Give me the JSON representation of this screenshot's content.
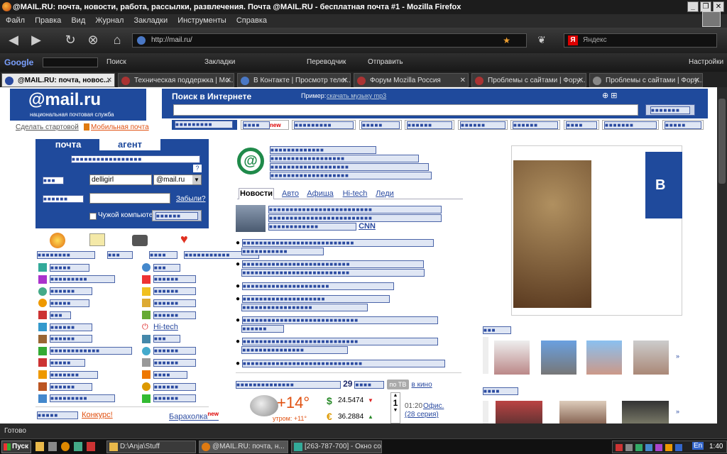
{
  "window": {
    "title": "@MAIL.RU: почта, новости, работа, рассылки, развлечения. Почта @MAIL.RU - бесплатная почта #1 - Mozilla Firefox"
  },
  "menu": [
    "Файл",
    "Правка",
    "Вид",
    "Журнал",
    "Закладки",
    "Инструменты",
    "Справка"
  ],
  "nav": {
    "url": "http://mail.ru/",
    "search_placeholder": "Яндекс"
  },
  "google_toolbar": {
    "logo": "Google",
    "search": "Поиск",
    "bookmarks": "Закладки",
    "translate": "Переводчик",
    "send": "Отправить",
    "settings": "Настройки"
  },
  "tabs": [
    {
      "label": "@MAIL.RU: почта, новос...",
      "active": true
    },
    {
      "label": "Техническая поддержка | Мо...",
      "active": false
    },
    {
      "label": "В Контакте | Просмотр телег...",
      "active": false
    },
    {
      "label": "Форум Mozilla Россия",
      "active": false
    },
    {
      "label": "Проблемы с сайтами | Фору...",
      "active": false
    },
    {
      "label": "Проблемы с сайтами | Фору...",
      "active": false
    }
  ],
  "page": {
    "logo": "@mail.ru",
    "logo_sub": "национальная почтовая служба",
    "make_start": "Сделать стартовой",
    "mobile_mail": "Мобильная почта",
    "search_title": "Поиск в Интернете",
    "search_example_label": "Пример:",
    "search_example": "скачать музыку mp3",
    "tab_mail": "почта",
    "tab_agent": "агент",
    "login_value": "delligirl",
    "domain_value": "@mail.ru",
    "forgot": "Забыли?",
    "alien_pc": "Чужой компьютер",
    "new_badge": "new",
    "news_tabs": [
      "Новости",
      "Авто",
      "Афиша",
      "Hi-tech",
      "Леди"
    ],
    "cnn": "CNN",
    "hitech": "Hi-tech",
    "contest": "Конкурс!",
    "baraholka": "Барахолка",
    "tv_number": "29",
    "tv_badge": "по ТВ",
    "tv_kino": "в кино",
    "temperature": "+14°",
    "temp_morning": "утром: +11°",
    "usd": "24.5474",
    "eur": "36.2884",
    "tv_time": "01:20",
    "tv_show": "Офис.",
    "tv_episode": "(28 серия)",
    "tv_channel": "1",
    "ad_letter": "B"
  },
  "status": {
    "text": "Готово"
  },
  "taskbar": {
    "start": "Пуск",
    "items": [
      "D:\\Anja\\Stuff",
      "@MAIL.RU: почта, н...",
      "[263-787-700] - Окно соо..."
    ],
    "lang": "En",
    "clock": "1:40"
  }
}
